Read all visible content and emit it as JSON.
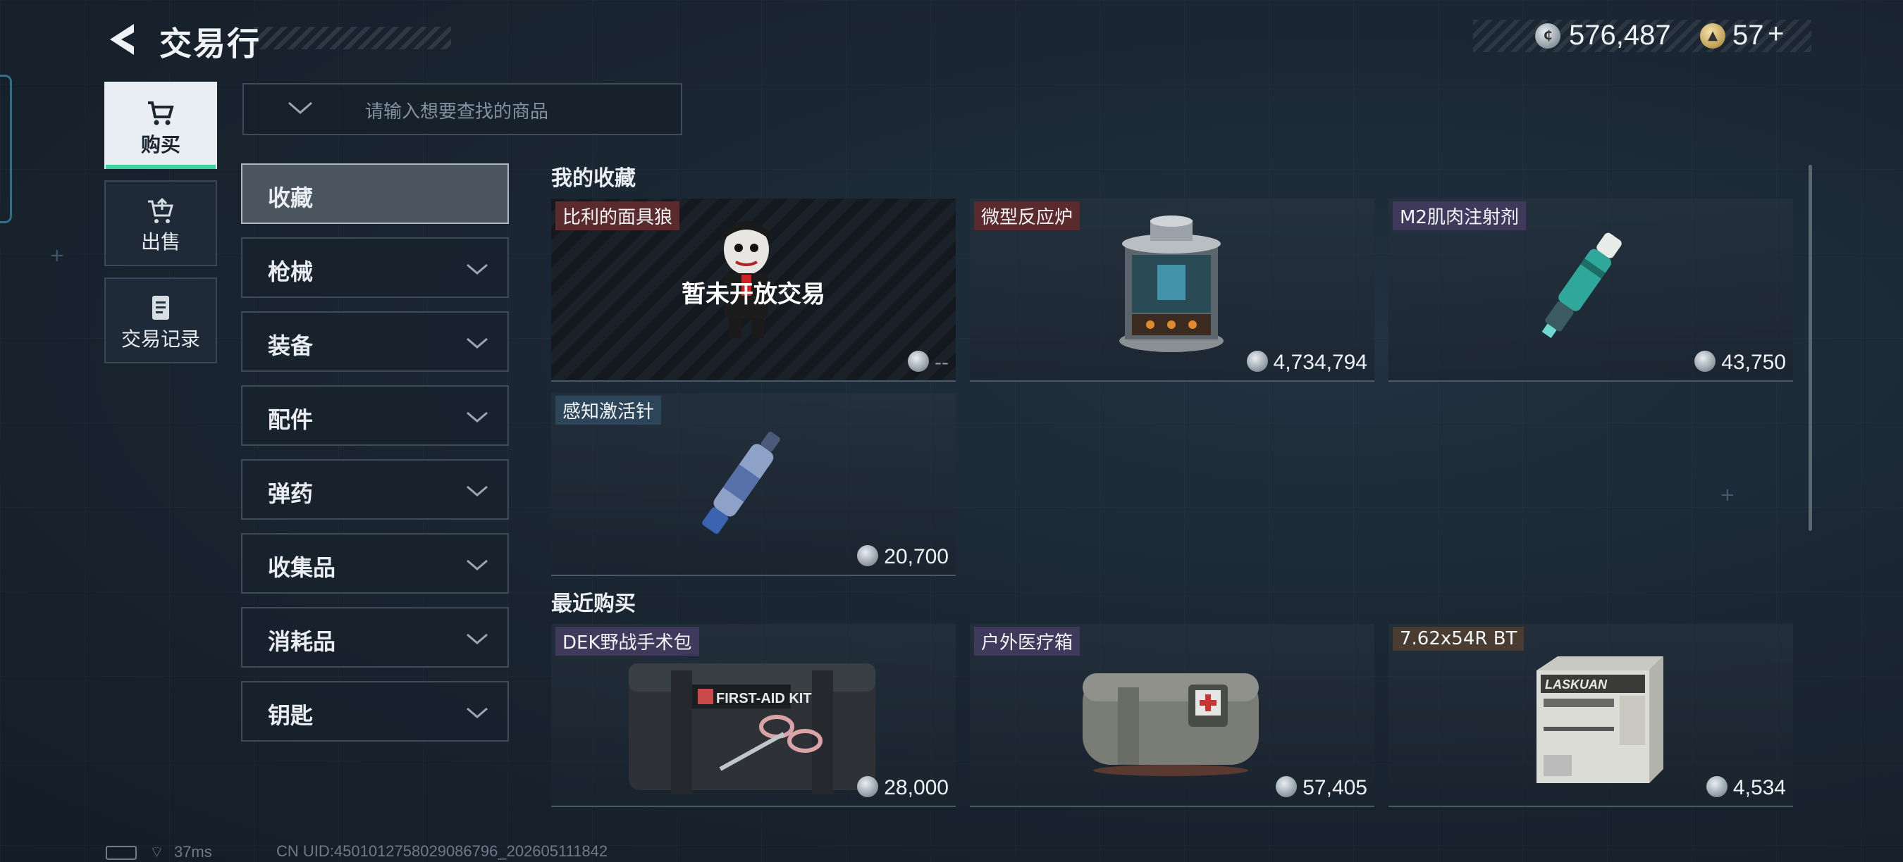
{
  "header": {
    "title": "交易行"
  },
  "currency": {
    "silver_amount": "576,487",
    "gold_amount": "57",
    "add_label": "+"
  },
  "nav": {
    "items": [
      {
        "label": "购买",
        "icon": "cart-icon",
        "active": true
      },
      {
        "label": "出售",
        "icon": "sell-cart-icon",
        "active": false
      },
      {
        "label": "交易记录",
        "icon": "record-icon",
        "active": false
      }
    ]
  },
  "search": {
    "placeholder": "请输入想要查找的商品"
  },
  "categories": [
    {
      "label": "收藏",
      "active": true
    },
    {
      "label": "枪械"
    },
    {
      "label": "装备"
    },
    {
      "label": "配件"
    },
    {
      "label": "弹药"
    },
    {
      "label": "收集品"
    },
    {
      "label": "消耗品"
    },
    {
      "label": "钥匙"
    }
  ],
  "favorites": {
    "title": "我的收藏",
    "items": [
      {
        "name": "比利的面具狼",
        "price": "--",
        "locked_text": "暂未开放交易",
        "tag_color": "red"
      },
      {
        "name": "微型反应炉",
        "price": "4,734,794",
        "tag_color": "red"
      },
      {
        "name": "M2肌肉注射剂",
        "price": "43,750",
        "tag_color": "purple"
      },
      {
        "name": "感知激活针",
        "price": "20,700",
        "tag_color": "blue"
      }
    ]
  },
  "recent": {
    "title": "最近购买",
    "items": [
      {
        "name": "DEK野战手术包",
        "price": "28,000",
        "tag_color": "purple",
        "kit_label": "FIRST-AID KIT"
      },
      {
        "name": "户外医疗箱",
        "price": "57,405",
        "tag_color": "purple"
      },
      {
        "name": "7.62x54R BT",
        "price": "4,534",
        "tag_color": "brown",
        "box_label": "LASKUAN"
      }
    ]
  },
  "footer": {
    "ping": "37ms",
    "uid": "CN UID:4501012758029086796_202605111842"
  },
  "colors": {
    "accent": "#3fd0a0",
    "background": "#1a2632",
    "panel": "#24323f"
  }
}
